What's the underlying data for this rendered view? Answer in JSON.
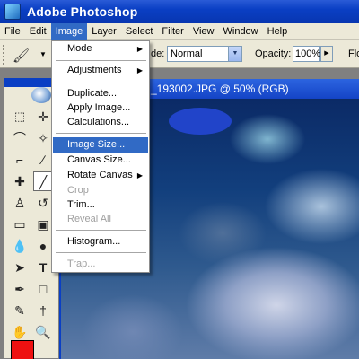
{
  "titlebar": {
    "title": "Adobe Photoshop"
  },
  "menubar": {
    "items": [
      "File",
      "Edit",
      "Image",
      "Layer",
      "Select",
      "Filter",
      "View",
      "Window",
      "Help"
    ],
    "active": "Image"
  },
  "options": {
    "mode_label": "de:",
    "mode_value": "Normal",
    "opacity_label": "Opacity:",
    "opacity_value": "100%",
    "flow_label": "Flo"
  },
  "document": {
    "title": "_193002.JPG @ 50% (RGB)"
  },
  "image_menu": {
    "mode": "Mode",
    "adjustments": "Adjustments",
    "duplicate": "Duplicate...",
    "apply_image": "Apply Image...",
    "calculations": "Calculations...",
    "image_size": "Image Size...",
    "canvas_size": "Canvas Size...",
    "rotate_canvas": "Rotate Canvas",
    "crop": "Crop",
    "trim": "Trim...",
    "reveal_all": "Reveal All",
    "histogram": "Histogram...",
    "trap": "Trap...",
    "highlighted": "Image Size...",
    "disabled": [
      "Crop",
      "Reveal All",
      "Trap..."
    ]
  },
  "toolbox": {
    "foreground_color": "#ee1111"
  },
  "icons": [
    "photoshop-logo-icon",
    "brush-icon",
    "marquee-icon",
    "move-icon",
    "lasso-icon",
    "magic-wand-icon",
    "crop-icon",
    "slice-icon",
    "healing-icon",
    "brush-tool-icon",
    "stamp-icon",
    "history-brush-icon",
    "eraser-icon",
    "gradient-icon",
    "blur-icon",
    "dodge-icon",
    "path-select-icon",
    "type-icon",
    "pen-icon",
    "shape-icon",
    "notes-icon",
    "eyedropper-icon",
    "hand-icon",
    "zoom-icon"
  ]
}
